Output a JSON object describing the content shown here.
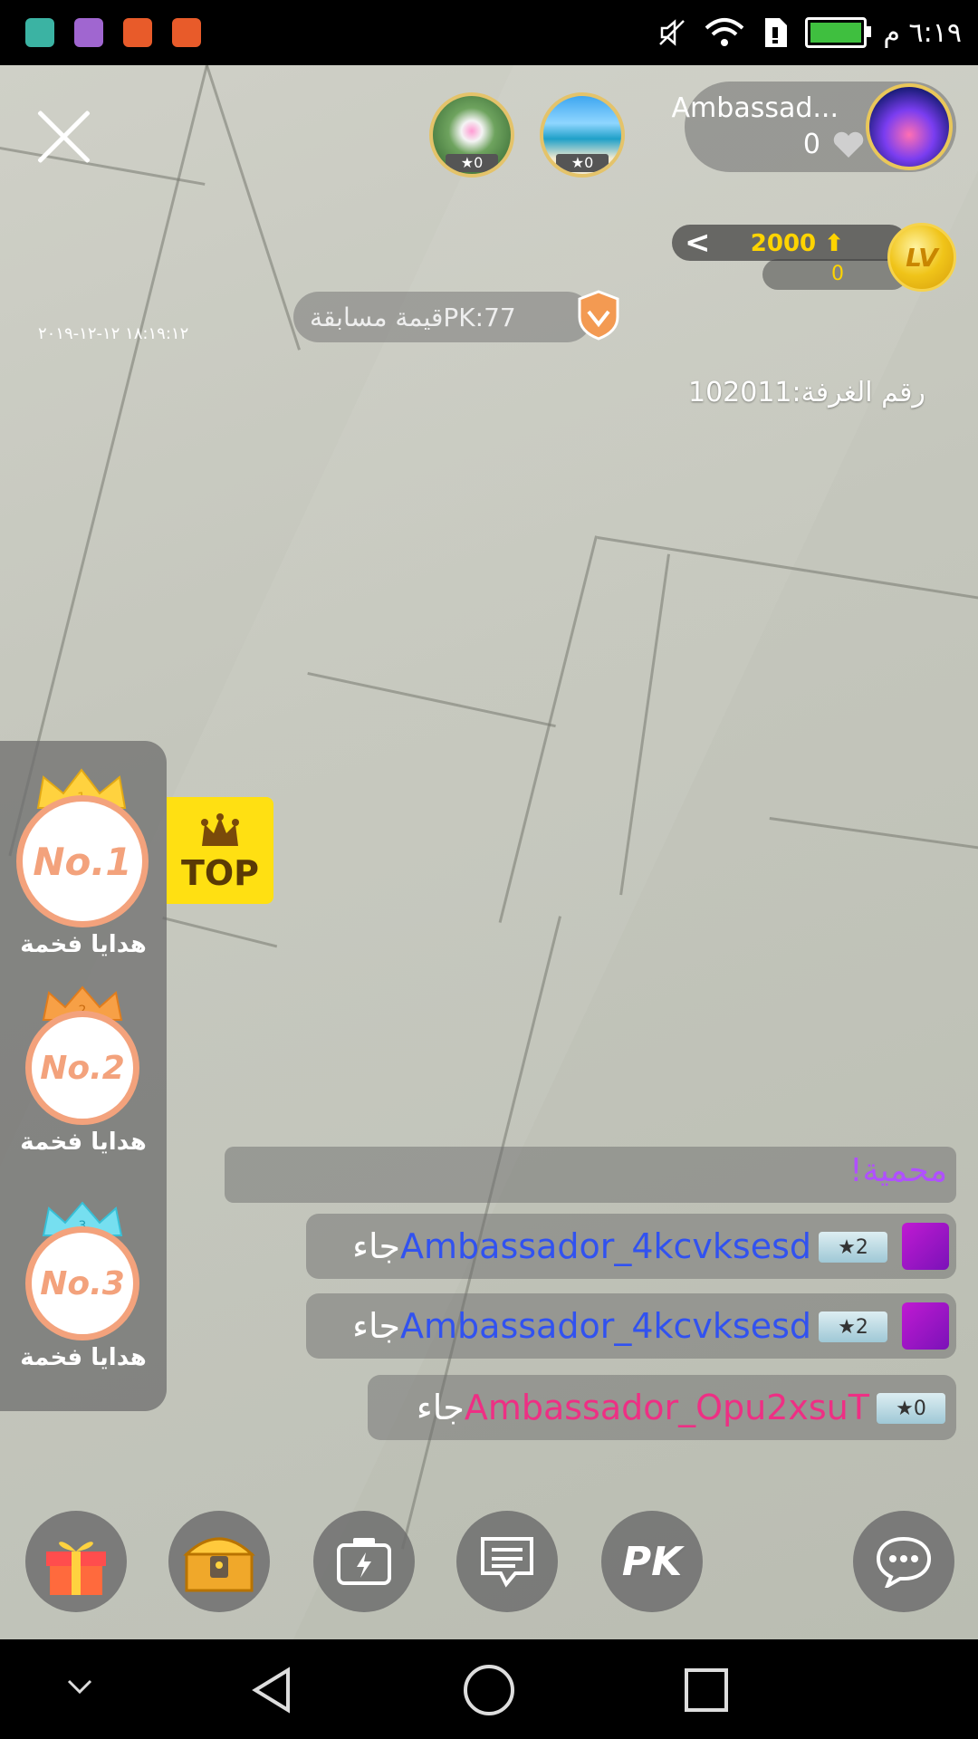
{
  "status_bar": {
    "time": "٦:١٩ م",
    "app_icon_colors": [
      "#3bb3a3",
      "#a066d0",
      "#e85b2a",
      "#e85b2a"
    ]
  },
  "live": {
    "timestamp": "١٨:١٩:١٢ ١٢-١٢-٢٠١٩",
    "pk_label": "قيمة مسابقةPK:77",
    "host": {
      "name": "Ambassad...",
      "count": "0"
    },
    "viewers": [
      {
        "stars": "0"
      },
      {
        "stars": "0"
      }
    ],
    "level": {
      "chevron": "<",
      "score": "2000",
      "sub": "0",
      "badge": "LV"
    },
    "room_id": "رقم الغرفة:102011"
  },
  "ranking": {
    "top_label": "TOP",
    "items": [
      {
        "rank": "No.1",
        "crown_num": "1",
        "label": "هدايا فخمة"
      },
      {
        "rank": "No.2",
        "crown_num": "2",
        "label": "هدايا فخمة"
      },
      {
        "rank": "No.3",
        "crown_num": "3",
        "label": "هدايا فخمة"
      }
    ]
  },
  "chat": {
    "system": "محمية!",
    "messages": [
      {
        "user": "Ambassador_4kcvksesd",
        "verb": "جاء",
        "level": "2"
      },
      {
        "user": "Ambassador_4kcvksesd",
        "verb": "جاء",
        "level": "2"
      },
      {
        "user": "Ambassador_Opu2xsuT",
        "verb": "جاء",
        "level": "0"
      }
    ]
  },
  "toolbar": {
    "pk_label": "PK"
  }
}
